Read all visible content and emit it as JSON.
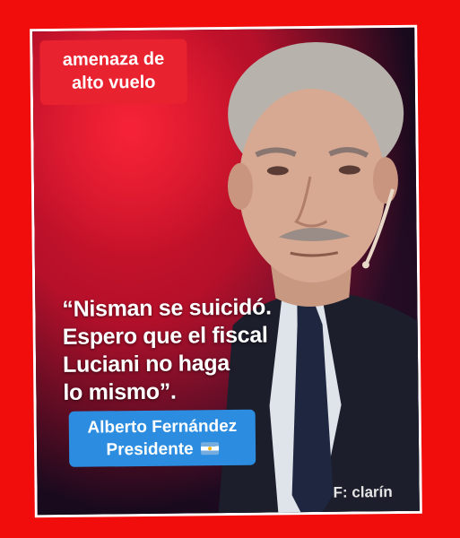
{
  "tag": {
    "line1": "amenaza de",
    "line2": "alto vuelo"
  },
  "quote": {
    "line1": "“Nisman se suicidó.",
    "line2": "Espero que el fiscal",
    "line3": "Luciani no haga",
    "line4": "lo mismo”."
  },
  "badge": {
    "name": "Alberto Fernández",
    "title": "Presidente"
  },
  "source": "F: clarín",
  "colors": {
    "background": "#f20d0d",
    "tag": "#e8222e",
    "badge": "#2c8de0"
  },
  "icons": [
    "argentina-flag-icon"
  ]
}
